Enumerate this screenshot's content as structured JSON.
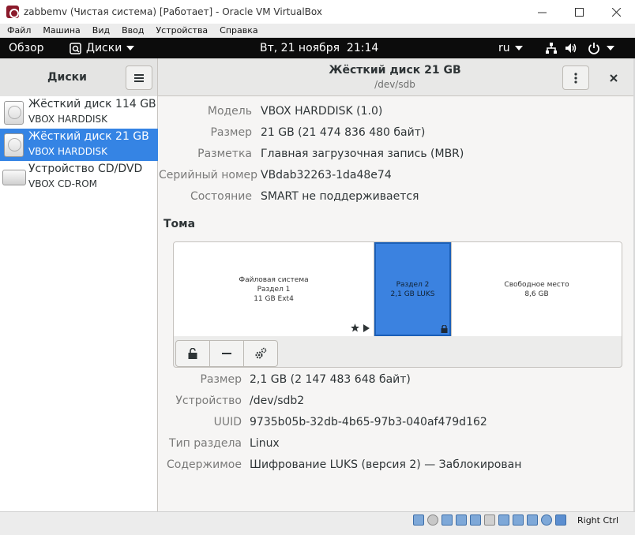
{
  "vbox": {
    "title": "zabbemv (Чистая система) [Работает] - Oracle VM VirtualBox",
    "menu": [
      "Файл",
      "Машина",
      "Вид",
      "Ввод",
      "Устройства",
      "Справка"
    ],
    "host_key": "Right Ctrl"
  },
  "topbar": {
    "activities": "Обзор",
    "app_menu": "Диски",
    "clock": "Вт, 21 ноября  21:14",
    "lang": "ru"
  },
  "sidebar": {
    "title": "Диски",
    "drives": [
      {
        "name": "Жёсткий диск 114 GB",
        "model": "VBOX HARDDISK",
        "selected": false
      },
      {
        "name": "Жёсткий диск 21 GB",
        "model": "VBOX HARDDISK",
        "selected": true
      },
      {
        "name": "Устройство CD/DVD",
        "model": "VBOX CD-ROM",
        "selected": false
      }
    ]
  },
  "header": {
    "title": "Жёсткий диск 21 GB",
    "subtitle": "/dev/sdb"
  },
  "disk": {
    "model_label": "Модель",
    "model": "VBOX HARDDISK (1.0)",
    "size_label": "Размер",
    "size": "21 GB (21 474 836 480 байт)",
    "partitioning_label": "Разметка",
    "partitioning": "Главная загрузочная запись (MBR)",
    "serial_label": "Серийный номер",
    "serial": "VBdab32263-1da48e74",
    "state_label": "Состояние",
    "state": "SMART не поддерживается"
  },
  "volumes": {
    "title": "Тома",
    "items": [
      {
        "line1": "Файловая система",
        "line2": "Раздел 1",
        "line3": "11 GB Ext4"
      },
      {
        "line1": "Раздел 2",
        "line2": "2,1 GB LUKS"
      },
      {
        "line1": "Свободное место",
        "line2": "8,6 GB"
      }
    ]
  },
  "partition": {
    "size_label": "Размер",
    "size": "2,1 GB (2 147 483 648 байт)",
    "device_label": "Устройство",
    "device": "/dev/sdb2",
    "uuid_label": "UUID",
    "uuid": "9735b05b-32db-4b65-97b3-040af479d162",
    "type_label": "Тип раздела",
    "type": "Linux",
    "contents_label": "Содержимое",
    "contents": "Шифрование LUKS (версия 2) — Заблокирован"
  },
  "colors": {
    "accent": "#3584e4",
    "selected_volume": "#3b82e0"
  }
}
